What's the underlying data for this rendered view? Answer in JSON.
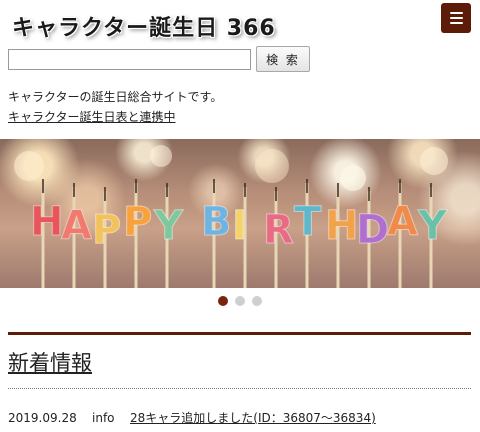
{
  "header": {
    "site_title": "キャラクター誕生日 366",
    "menu_icon": "hamburger-menu-icon",
    "accent_color": "#5c1c08"
  },
  "search": {
    "value": "",
    "placeholder": "",
    "button_label": "検 索"
  },
  "intro": {
    "tagline": "キャラクターの誕生日総合サイトです。",
    "link_text": "キャラクター誕生日表と連携中"
  },
  "banner": {
    "text": "HAPPY BIRTHDAY",
    "letter_colors": [
      "#e8555a",
      "#f07a6e",
      "#f2c25c",
      "#f7a23c",
      "#7ec8a0",
      "#6fb3e0",
      "#f5d36a",
      "#e86a84",
      "#5fb7c9",
      "#f2a24a",
      "#b06fcf",
      "#f08a4b",
      "#6cc0a8"
    ]
  },
  "slider": {
    "dot_count": 3,
    "active_index": 0
  },
  "news": {
    "section_title": "新着情報",
    "items": [
      {
        "date": "2019.09.28",
        "category": "info",
        "title": "28キャラ追加しました(ID：36807～36834)"
      }
    ]
  }
}
